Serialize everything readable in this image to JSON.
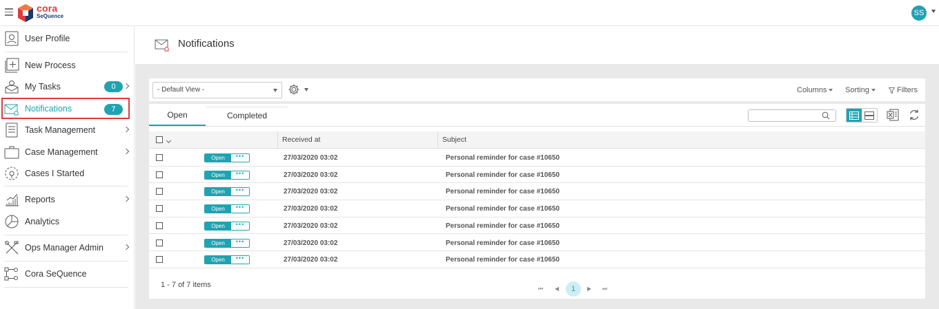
{
  "app": {
    "brand_line1": "cora",
    "brand_line2": "SeQuence",
    "user_initials": "SS"
  },
  "sidebar": {
    "items": [
      {
        "label": "User Profile",
        "icon": "user-profile-icon"
      },
      {
        "label": "New Process",
        "icon": "new-process-icon"
      },
      {
        "label": "My Tasks",
        "icon": "my-tasks-icon",
        "badge": "0"
      },
      {
        "label": "Notifications",
        "icon": "notifications-icon",
        "badge": "7",
        "active": true
      },
      {
        "label": "Task Management",
        "icon": "task-management-icon"
      },
      {
        "label": "Case Management",
        "icon": "case-management-icon"
      },
      {
        "label": "Cases I Started",
        "icon": "cases-started-icon"
      },
      {
        "label": "Reports",
        "icon": "reports-icon"
      },
      {
        "label": "Analytics",
        "icon": "analytics-icon"
      },
      {
        "label": "Ops Manager Admin",
        "icon": "ops-manager-icon"
      },
      {
        "label": "Cora SeQuence",
        "icon": "cora-sequence-icon"
      }
    ]
  },
  "page": {
    "title": "Notifications"
  },
  "toolbar": {
    "view_select": "- Default View -",
    "columns": "Columns",
    "sorting": "Sorting",
    "filters": "Filters"
  },
  "tabs": {
    "open": "Open",
    "completed": "Completed"
  },
  "search": {
    "placeholder": ""
  },
  "grid": {
    "columns": [
      "Received at",
      "Subject"
    ],
    "rows": [
      {
        "status": "Open",
        "received_at": "27/03/2020 03:02",
        "subject": "Personal reminder for case #10650"
      },
      {
        "status": "Open",
        "received_at": "27/03/2020 03:02",
        "subject": "Personal reminder for case #10650"
      },
      {
        "status": "Open",
        "received_at": "27/03/2020 03:02",
        "subject": "Personal reminder for case #10650"
      },
      {
        "status": "Open",
        "received_at": "27/03/2020 03:02",
        "subject": "Personal reminder for case #10650"
      },
      {
        "status": "Open",
        "received_at": "27/03/2020 03:02",
        "subject": "Personal reminder for case #10650"
      },
      {
        "status": "Open",
        "received_at": "27/03/2020 03:02",
        "subject": "Personal reminder for case #10650"
      },
      {
        "status": "Open",
        "received_at": "27/03/2020 03:02",
        "subject": "Personal reminder for case #10650"
      }
    ],
    "actions_glyph": "•••"
  },
  "pager": {
    "info": "1 - 7 of 7 items",
    "current_page": "1",
    "first": "⏮",
    "prev": "◀",
    "next": "▶",
    "last": "⏭"
  },
  "colors": {
    "accent": "#1fa3b1",
    "highlight": "#e0393e"
  }
}
